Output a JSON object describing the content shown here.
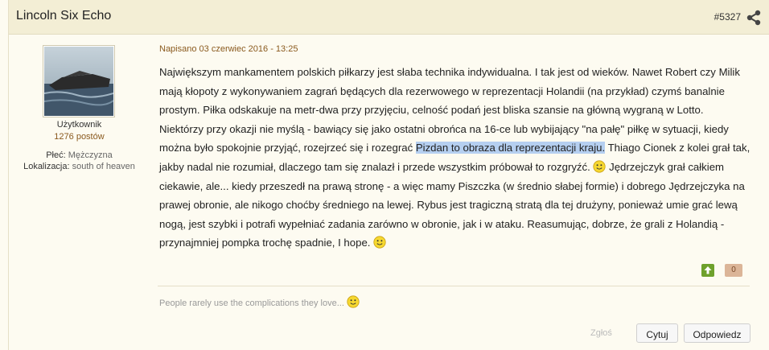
{
  "post": {
    "author": "Lincoln Six Echo",
    "id": "#5327",
    "date": "Napisano 03 czerwiec 2016 - 13:25",
    "user": {
      "role": "Użytkownik",
      "posts": "1276 postów",
      "gender_label": "Płeć:",
      "gender_value": "Mężczyzna",
      "location_label": "Lokalizacja:",
      "location_value": "south of heaven"
    },
    "body": {
      "part1": "Największym mankamentem polskich piłkarzy jest słaba technika indywidualna. I tak jest od wieków. Nawet Robert czy Milik mają kłopoty z wykonywaniem zagrań będących dla rezerwowego w reprezentacji Holandii (na przykład) czymś banalnie prostym. Piłka odskakuje na metr-dwa przy przyjęciu, celność podań jest bliska szansie na główną wygraną w Lotto. Niektórzy przy okazji nie myślą - bawiący się jako ostatni obrońca na 16-ce lub wybijający \"na pałę\" piłkę w sytuacji, kiedy można było spokojnie przyjąć, rozejrzeć się i rozegrać ",
      "highlight": "Pizdan to obraza dla reprezentacji kraju.",
      "part2": " Thiago Cionek z kolei grał tak, jakby nadal nie rozumiał, dlaczego tam się znalazł i przede wszystkim próbował to rozgryźć. ",
      "part3": " Jędrzejczyk grał całkiem ciekawie, ale... kiedy przeszedł na prawą stronę - a więc mamy Piszczka (w średnio słabej formie) i dobrego Jędrzejczyka na prawej obronie, ale nikogo choćby średniego na lewej. Rybus jest tragiczną stratą dla tej drużyny, ponieważ umie grać lewą nogą, jest szybki i potrafi wypełniać zadania zarówno w obronie, jak i w ataku. Reasumując, dobrze, że grali z Holandią - przynajmniej pompka trochę spadnie, I hope. "
    },
    "reputation": "0",
    "signature": "People rarely use the complications they love...",
    "actions": {
      "report": "Zgłoś",
      "quote": "Cytuj",
      "reply": "Odpowiedz"
    },
    "icons": {
      "share": "share-icon",
      "smiley": "smiley-icon",
      "vote_up": "arrow-up-icon"
    }
  }
}
